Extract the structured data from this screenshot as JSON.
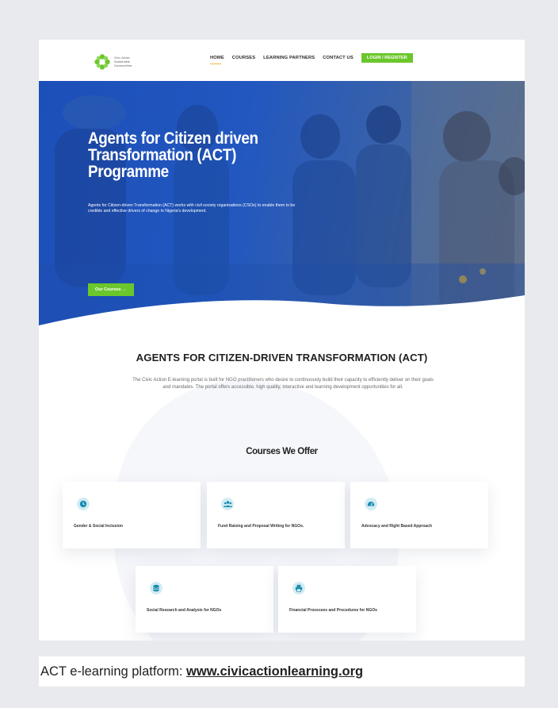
{
  "logo": {
    "lines": [
      "Civic Action",
      "Sustainable",
      "Communities"
    ],
    "accent_color": "#6bc72c"
  },
  "nav": {
    "items": [
      {
        "label": "HOME",
        "active": true
      },
      {
        "label": "COURSES"
      },
      {
        "label": "LEARNING PARTNERS"
      },
      {
        "label": "CONTACT US"
      }
    ],
    "login_label": "LOGIN / REGISTER"
  },
  "hero": {
    "title_lines": [
      "Agents for Citizen driven",
      "Transformation (ACT)",
      "Programme"
    ],
    "text": "Agents for Citizen-driven Transformation (ACT) works with civil society organisations (CSOs) to enable them to be credible and effective drivers of change in Nigeria's development.",
    "button_label": "Our Courses  →",
    "overlay_color": "#1d4fb8"
  },
  "intro": {
    "title": "AGENTS FOR CITIZEN-DRIVEN TRANSFORMATION (ACT)",
    "text": "The Civic Action E-learning portal is built for NGO practitioners who desire to continuously build their capacity to efficiently deliver on their goals and mandates. The portal offers accessible, high quality, interactive and learning development opportunities for all."
  },
  "courses": {
    "title": "Courses We Offer",
    "items": [
      {
        "label": "Gender & Social Inclusion",
        "icon": "clock-icon"
      },
      {
        "label": "Fund Raising and Proposal Writing for NGOs.",
        "icon": "users-icon"
      },
      {
        "label": "Advocacy and Right Based Approach",
        "icon": "gauge-icon"
      },
      {
        "label": "Social Research and Analysis for NGOs",
        "icon": "database-icon"
      },
      {
        "label": "Financial Processes and Procedures for NGOs",
        "icon": "print-icon"
      }
    ],
    "icon_color": "#1a8db0"
  },
  "caption": {
    "prefix": "ACT e-learning platform: ",
    "link": "www.civicactionlearning.org"
  }
}
